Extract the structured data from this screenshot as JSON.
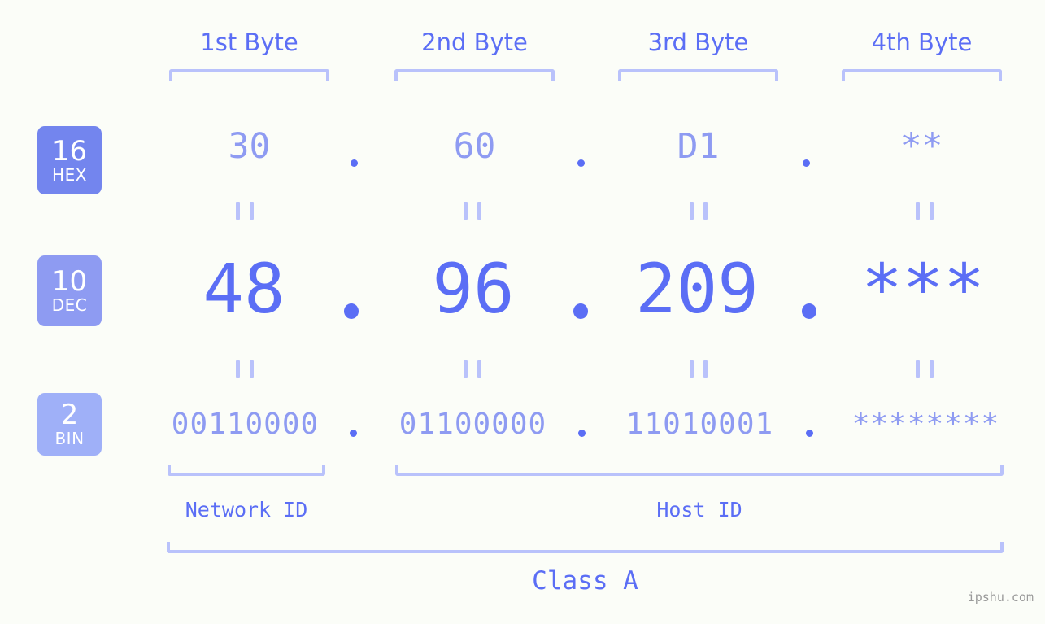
{
  "page": {
    "background_color": "#fbfdf8",
    "accent_color": "#5b6ef5",
    "accent_light_color": "#8e9bf2",
    "bracket_color": "#b9c2fb",
    "watermark": "ipshu.com"
  },
  "byte_headers": [
    {
      "label": "1st Byte"
    },
    {
      "label": "2nd Byte"
    },
    {
      "label": "3rd Byte"
    },
    {
      "label": "4th Byte"
    }
  ],
  "radix_badges": [
    {
      "number": "16",
      "word": "HEX",
      "color": "#7385ee"
    },
    {
      "number": "10",
      "word": "DEC",
      "color": "#8e9bf2"
    },
    {
      "number": "2",
      "word": "BIN",
      "color": "#9fb0f8"
    }
  ],
  "rows": {
    "hex": {
      "radix": "16",
      "name": "HEX",
      "values": [
        "30",
        "60",
        "D1",
        "**"
      ],
      "separator": "."
    },
    "dec": {
      "radix": "10",
      "name": "DEC",
      "values": [
        "48",
        "96",
        "209",
        "***"
      ],
      "separator": "."
    },
    "bin": {
      "radix": "2",
      "name": "BIN",
      "values": [
        "00110000",
        "01100000",
        "11010001",
        "********"
      ],
      "separator": "."
    }
  },
  "equals_marks": {
    "glyph": "=",
    "count_per_row_gap": 4
  },
  "id_labels": [
    {
      "label": "Network ID"
    },
    {
      "label": "Host ID"
    }
  ],
  "class_label": "Class A"
}
